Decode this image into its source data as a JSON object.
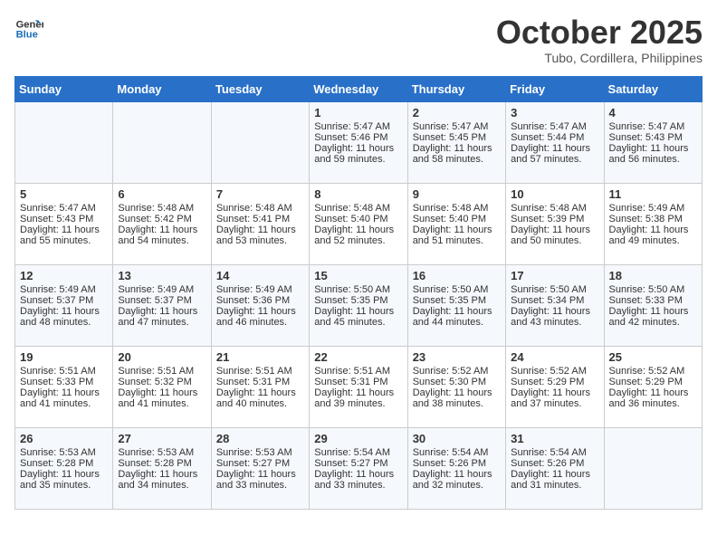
{
  "header": {
    "logo_line1": "General",
    "logo_line2": "Blue",
    "month": "October 2025",
    "location": "Tubo, Cordillera, Philippines"
  },
  "weekdays": [
    "Sunday",
    "Monday",
    "Tuesday",
    "Wednesday",
    "Thursday",
    "Friday",
    "Saturday"
  ],
  "weeks": [
    [
      {
        "day": "",
        "info": ""
      },
      {
        "day": "",
        "info": ""
      },
      {
        "day": "",
        "info": ""
      },
      {
        "day": "1",
        "info": "Sunrise: 5:47 AM\nSunset: 5:46 PM\nDaylight: 11 hours and 59 minutes."
      },
      {
        "day": "2",
        "info": "Sunrise: 5:47 AM\nSunset: 5:45 PM\nDaylight: 11 hours and 58 minutes."
      },
      {
        "day": "3",
        "info": "Sunrise: 5:47 AM\nSunset: 5:44 PM\nDaylight: 11 hours and 57 minutes."
      },
      {
        "day": "4",
        "info": "Sunrise: 5:47 AM\nSunset: 5:43 PM\nDaylight: 11 hours and 56 minutes."
      }
    ],
    [
      {
        "day": "5",
        "info": "Sunrise: 5:47 AM\nSunset: 5:43 PM\nDaylight: 11 hours and 55 minutes."
      },
      {
        "day": "6",
        "info": "Sunrise: 5:48 AM\nSunset: 5:42 PM\nDaylight: 11 hours and 54 minutes."
      },
      {
        "day": "7",
        "info": "Sunrise: 5:48 AM\nSunset: 5:41 PM\nDaylight: 11 hours and 53 minutes."
      },
      {
        "day": "8",
        "info": "Sunrise: 5:48 AM\nSunset: 5:40 PM\nDaylight: 11 hours and 52 minutes."
      },
      {
        "day": "9",
        "info": "Sunrise: 5:48 AM\nSunset: 5:40 PM\nDaylight: 11 hours and 51 minutes."
      },
      {
        "day": "10",
        "info": "Sunrise: 5:48 AM\nSunset: 5:39 PM\nDaylight: 11 hours and 50 minutes."
      },
      {
        "day": "11",
        "info": "Sunrise: 5:49 AM\nSunset: 5:38 PM\nDaylight: 11 hours and 49 minutes."
      }
    ],
    [
      {
        "day": "12",
        "info": "Sunrise: 5:49 AM\nSunset: 5:37 PM\nDaylight: 11 hours and 48 minutes."
      },
      {
        "day": "13",
        "info": "Sunrise: 5:49 AM\nSunset: 5:37 PM\nDaylight: 11 hours and 47 minutes."
      },
      {
        "day": "14",
        "info": "Sunrise: 5:49 AM\nSunset: 5:36 PM\nDaylight: 11 hours and 46 minutes."
      },
      {
        "day": "15",
        "info": "Sunrise: 5:50 AM\nSunset: 5:35 PM\nDaylight: 11 hours and 45 minutes."
      },
      {
        "day": "16",
        "info": "Sunrise: 5:50 AM\nSunset: 5:35 PM\nDaylight: 11 hours and 44 minutes."
      },
      {
        "day": "17",
        "info": "Sunrise: 5:50 AM\nSunset: 5:34 PM\nDaylight: 11 hours and 43 minutes."
      },
      {
        "day": "18",
        "info": "Sunrise: 5:50 AM\nSunset: 5:33 PM\nDaylight: 11 hours and 42 minutes."
      }
    ],
    [
      {
        "day": "19",
        "info": "Sunrise: 5:51 AM\nSunset: 5:33 PM\nDaylight: 11 hours and 41 minutes."
      },
      {
        "day": "20",
        "info": "Sunrise: 5:51 AM\nSunset: 5:32 PM\nDaylight: 11 hours and 41 minutes."
      },
      {
        "day": "21",
        "info": "Sunrise: 5:51 AM\nSunset: 5:31 PM\nDaylight: 11 hours and 40 minutes."
      },
      {
        "day": "22",
        "info": "Sunrise: 5:51 AM\nSunset: 5:31 PM\nDaylight: 11 hours and 39 minutes."
      },
      {
        "day": "23",
        "info": "Sunrise: 5:52 AM\nSunset: 5:30 PM\nDaylight: 11 hours and 38 minutes."
      },
      {
        "day": "24",
        "info": "Sunrise: 5:52 AM\nSunset: 5:29 PM\nDaylight: 11 hours and 37 minutes."
      },
      {
        "day": "25",
        "info": "Sunrise: 5:52 AM\nSunset: 5:29 PM\nDaylight: 11 hours and 36 minutes."
      }
    ],
    [
      {
        "day": "26",
        "info": "Sunrise: 5:53 AM\nSunset: 5:28 PM\nDaylight: 11 hours and 35 minutes."
      },
      {
        "day": "27",
        "info": "Sunrise: 5:53 AM\nSunset: 5:28 PM\nDaylight: 11 hours and 34 minutes."
      },
      {
        "day": "28",
        "info": "Sunrise: 5:53 AM\nSunset: 5:27 PM\nDaylight: 11 hours and 33 minutes."
      },
      {
        "day": "29",
        "info": "Sunrise: 5:54 AM\nSunset: 5:27 PM\nDaylight: 11 hours and 33 minutes."
      },
      {
        "day": "30",
        "info": "Sunrise: 5:54 AM\nSunset: 5:26 PM\nDaylight: 11 hours and 32 minutes."
      },
      {
        "day": "31",
        "info": "Sunrise: 5:54 AM\nSunset: 5:26 PM\nDaylight: 11 hours and 31 minutes."
      },
      {
        "day": "",
        "info": ""
      }
    ]
  ]
}
